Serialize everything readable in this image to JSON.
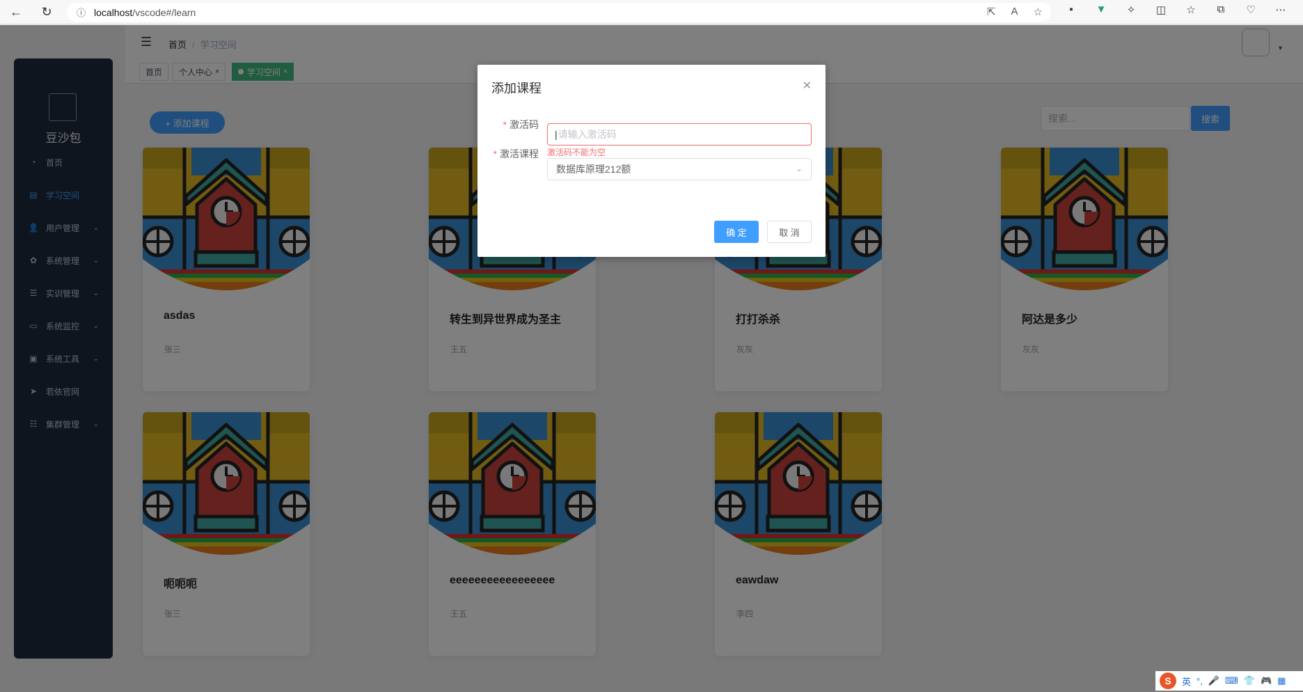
{
  "browser": {
    "url_host": "localhost",
    "url_path": "/vscode#/learn"
  },
  "sidebar": {
    "brand": "豆沙包",
    "items": [
      {
        "label": "首页",
        "icon": "dashboard-icon",
        "glyph": "◔",
        "has_children": false,
        "active": false
      },
      {
        "label": "学习空间",
        "icon": "book-icon",
        "glyph": "▤",
        "has_children": false,
        "active": true
      },
      {
        "label": "用户管理",
        "icon": "user-icon",
        "glyph": "👤",
        "has_children": true,
        "active": false
      },
      {
        "label": "系统管理",
        "icon": "gear-icon",
        "glyph": "✿",
        "has_children": true,
        "active": false
      },
      {
        "label": "实训管理",
        "icon": "list-icon",
        "glyph": "☰",
        "has_children": true,
        "active": false
      },
      {
        "label": "系统监控",
        "icon": "monitor-icon",
        "glyph": "▭",
        "has_children": true,
        "active": false
      },
      {
        "label": "系统工具",
        "icon": "toolbox-icon",
        "glyph": "▣",
        "has_children": true,
        "active": false
      },
      {
        "label": "若依官网",
        "icon": "send-icon",
        "glyph": "➤",
        "has_children": false,
        "active": false
      },
      {
        "label": "集群管理",
        "icon": "sliders-icon",
        "glyph": "☷",
        "has_children": true,
        "active": false
      }
    ]
  },
  "header": {
    "breadcrumb": [
      "首页",
      "学习空间"
    ]
  },
  "tags": [
    {
      "label": "首页",
      "active": false,
      "closable": false
    },
    {
      "label": "个人中心",
      "active": false,
      "closable": true
    },
    {
      "label": "学习空间",
      "active": true,
      "closable": true
    }
  ],
  "toolbar": {
    "add_label": "+ 添加课程",
    "search_placeholder": "搜索...",
    "search_button": "搜索"
  },
  "courses": [
    {
      "title": "asdas",
      "teacher": "张三"
    },
    {
      "title": "转生到异世界成为圣主",
      "teacher": "王五"
    },
    {
      "title": "打打杀杀",
      "teacher": "灰灰"
    },
    {
      "title": "阿达是多少",
      "teacher": "灰灰"
    },
    {
      "title": "呃呃呃",
      "teacher": "张三"
    },
    {
      "title": "eeeeeeeeeeeeeeeee",
      "teacher": "王五"
    },
    {
      "title": "eawdaw",
      "teacher": "李四"
    }
  ],
  "dialog": {
    "title": "添加课程",
    "code_label": "激活码",
    "code_placeholder": "请输入激活码",
    "code_error": "激活码不能为空",
    "course_label": "激活课程",
    "course_value": "数据库原理212额",
    "confirm": "确 定",
    "cancel": "取 消"
  },
  "ime": {
    "logo": "S",
    "lang": "英"
  },
  "colors": {
    "primary": "#409eff",
    "sidebar_bg": "#1e2a3c",
    "error": "#f56c6c",
    "tag_active": "#42b983"
  }
}
